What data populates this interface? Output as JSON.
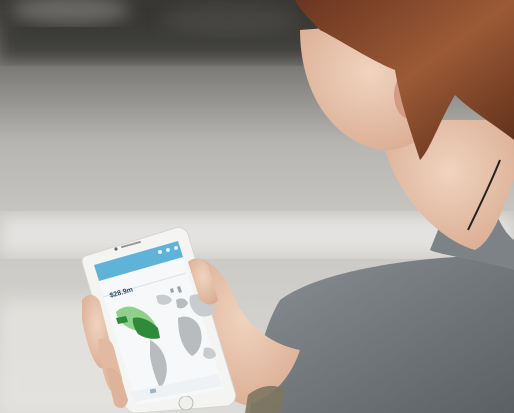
{
  "scene": {
    "description_tags": [
      "photo-background",
      "person",
      "smartphone",
      "map-app"
    ]
  },
  "phone_screen": {
    "app_title": "",
    "card_subtitle": "",
    "card_value": "$28.9m",
    "footer_text": ""
  },
  "colors": {
    "app_bar": "#5fb3d9",
    "map_green_dark": "#2e8b3a",
    "map_green_light": "#8fd18a",
    "map_gray": "#b8bcbf",
    "hair": "#8a4a2a",
    "sweater": "#6f7478"
  }
}
